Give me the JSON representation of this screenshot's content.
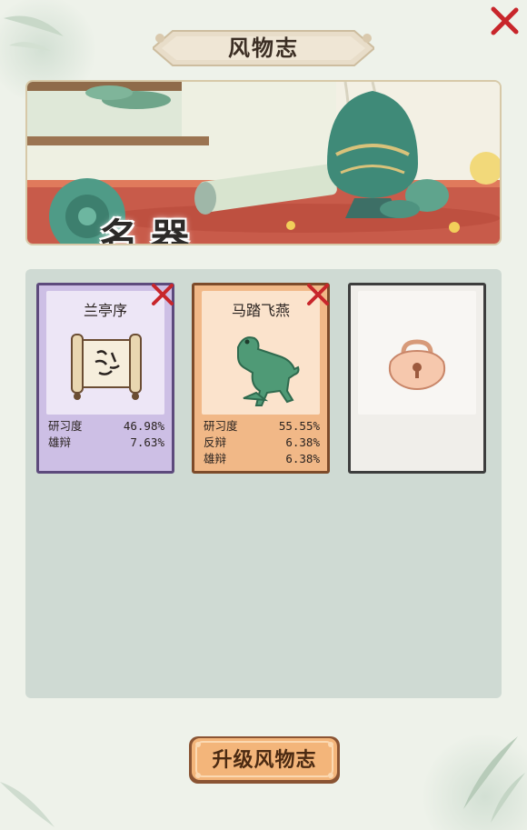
{
  "window": {
    "title": "风物志"
  },
  "hero": {
    "label": "名器"
  },
  "cards": [
    {
      "name": "兰亭序",
      "theme": "purple",
      "icon": "scroll-icon",
      "stats": [
        {
          "label": "研习度",
          "value": "46.98%"
        },
        {
          "label": "雄辩",
          "value": "7.63%"
        }
      ]
    },
    {
      "name": "马踏飞燕",
      "theme": "orange",
      "icon": "bronze-horse-icon",
      "stats": [
        {
          "label": "研习度",
          "value": "55.55%"
        },
        {
          "label": "反辩",
          "value": "6.38%"
        },
        {
          "label": "雄辩",
          "value": "6.38%"
        }
      ]
    },
    {
      "name": "",
      "theme": "locked",
      "icon": "lock-icon",
      "stats": []
    }
  ],
  "actions": {
    "upgrade_label": "升级风物志"
  },
  "colors": {
    "panel_bg": "#cfdad3",
    "purple_card": "#cdbfe5",
    "orange_card": "#f1b887",
    "close_red": "#c8262b",
    "button_orange": "#f3b57a"
  }
}
